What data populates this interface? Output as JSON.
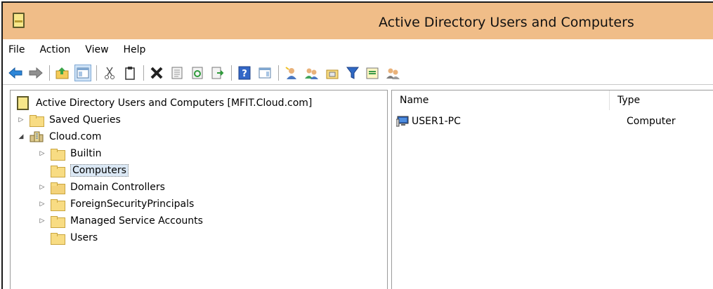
{
  "window": {
    "title": "Active Directory Users and Computers"
  },
  "menu": [
    {
      "label": "File"
    },
    {
      "label": "Action"
    },
    {
      "label": "View"
    },
    {
      "label": "Help"
    }
  ],
  "toolbar": {
    "buttons": [
      {
        "icon": "back-arrow-icon"
      },
      {
        "icon": "forward-arrow-icon"
      },
      {
        "icon": "up-folder-icon"
      },
      {
        "icon": "show-hide-console-tree-icon",
        "active": true
      },
      {
        "icon": "cut-icon"
      },
      {
        "icon": "copy-icon"
      },
      {
        "icon": "delete-icon"
      },
      {
        "icon": "properties-icon"
      },
      {
        "icon": "refresh-icon"
      },
      {
        "icon": "export-list-icon"
      },
      {
        "icon": "help-icon"
      },
      {
        "icon": "action-pane-icon"
      },
      {
        "icon": "new-user-icon"
      },
      {
        "icon": "new-group-icon"
      },
      {
        "icon": "new-ou-icon"
      },
      {
        "icon": "filter-icon"
      },
      {
        "icon": "find-icon"
      },
      {
        "icon": "add-to-group-icon"
      }
    ]
  },
  "tree": {
    "root": "Active Directory Users and Computers [MFIT.Cloud.com]",
    "items": [
      {
        "label": "Saved Queries",
        "expander": "▷"
      },
      {
        "label": "Cloud.com",
        "expander": "◢"
      },
      {
        "label": "Builtin",
        "expander": "▷"
      },
      {
        "label": "Computers",
        "expander": "",
        "selected": true
      },
      {
        "label": "Domain Controllers",
        "expander": "▷"
      },
      {
        "label": "ForeignSecurityPrincipals",
        "expander": "▷"
      },
      {
        "label": "Managed Service Accounts",
        "expander": "▷"
      },
      {
        "label": "Users",
        "expander": ""
      }
    ]
  },
  "list": {
    "columns": [
      "Name",
      "Type"
    ],
    "rows": [
      {
        "name": "USER1-PC",
        "type": "Computer",
        "icon": "computer-icon"
      }
    ]
  },
  "colors": {
    "titlebar": "#f0bd88",
    "selection": "#dbe8f5",
    "folder": "#f8dc83"
  }
}
